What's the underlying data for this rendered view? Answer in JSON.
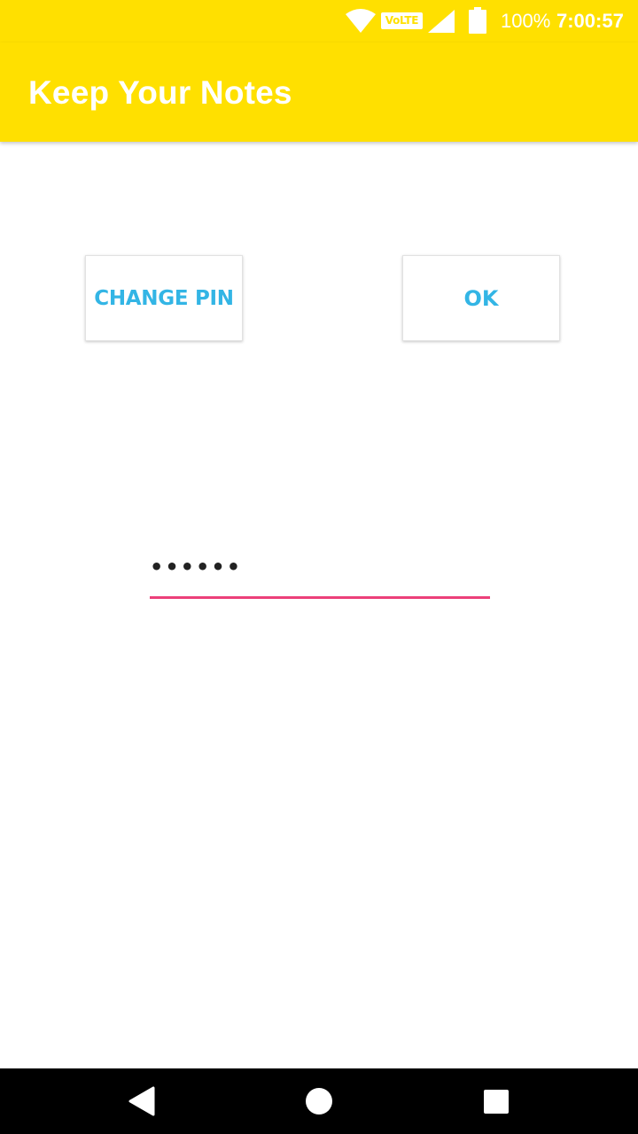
{
  "status_bar": {
    "volte_label": "VoLTE",
    "battery_text": "100%",
    "clock": "7:00:57",
    "icons": [
      "wifi-icon",
      "volte-icon",
      "signal-icon",
      "battery-icon"
    ]
  },
  "app_bar": {
    "title": "Keep Your Notes"
  },
  "buttons": {
    "change_pin_label": "CHANGE PIN",
    "ok_label": "OK"
  },
  "pin_field": {
    "value": "••••••"
  },
  "nav_bar": {
    "icons": [
      "back-icon",
      "home-icon",
      "recents-icon"
    ]
  },
  "colors": {
    "primary": "#FFE000",
    "button_text": "#33B5E5",
    "field_accent": "#EC407A",
    "nav_bar": "#000000"
  }
}
